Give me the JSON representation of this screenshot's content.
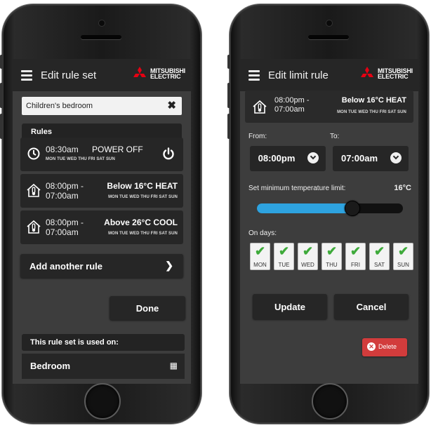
{
  "colors": {
    "accent_blue": "#2ea3e0",
    "brand_red": "#e60012",
    "check_green": "#3eaa3a",
    "delete_red": "#d23c3c"
  },
  "left_screen": {
    "title": "Edit rule set",
    "brand": {
      "line1": "MITSUBISHI",
      "line2": "ELECTRIC"
    },
    "rule_set_name": "Children's bedroom",
    "rules_header": "Rules",
    "rules": [
      {
        "icon": "clock-icon",
        "time": "08:30am",
        "action": "POWER OFF",
        "days": "MON TUE WED THU FRI SAT SUN",
        "action_icon": "power-icon"
      },
      {
        "icon": "thermometer-house-icon",
        "time_from": "08:00pm -",
        "time_to": "07:00am",
        "action": "Below 16°C HEAT",
        "days": "MON TUE WED THU FRI SAT SUN"
      },
      {
        "icon": "thermometer-house-icon",
        "time_from": "08:00pm -",
        "time_to": "07:00am",
        "action": "Above 26°C COOL",
        "days": "MON TUE WED THU FRI SAT SUN"
      }
    ],
    "add_rule_label": "Add another rule",
    "done_label": "Done",
    "used_on_header": "This rule set is used on:",
    "used_on_item": "Bedroom"
  },
  "right_screen": {
    "title": "Edit limit rule",
    "brand": {
      "line1": "MITSUBISHI",
      "line2": "ELECTRIC"
    },
    "summary": {
      "time_from": "08:00pm -",
      "time_to": "07:00am",
      "action": "Below 16°C HEAT",
      "days": "MON TUE WED THU FRI SAT SUN"
    },
    "from_label": "From:",
    "to_label": "To:",
    "from_value": "08:00pm",
    "to_value": "07:00am",
    "limit_label": "Set minimum temperature limit:",
    "limit_value": "16°C",
    "slider_fraction": 0.65,
    "on_days_label": "On days:",
    "days": [
      {
        "label": "MON",
        "checked": true
      },
      {
        "label": "TUE",
        "checked": true
      },
      {
        "label": "WED",
        "checked": true
      },
      {
        "label": "THU",
        "checked": true
      },
      {
        "label": "FRI",
        "checked": true
      },
      {
        "label": "SAT",
        "checked": true
      },
      {
        "label": "SUN",
        "checked": true
      }
    ],
    "update_label": "Update",
    "cancel_label": "Cancel",
    "delete_label": "Delete"
  }
}
